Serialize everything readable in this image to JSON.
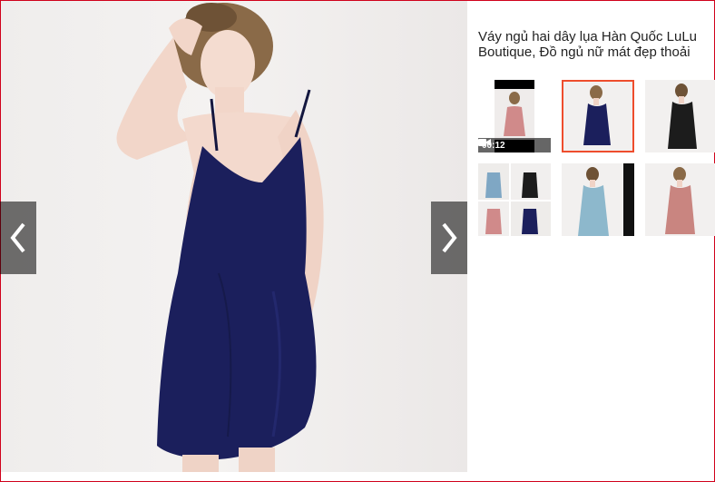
{
  "product": {
    "title_line1": "Váy ngủ hai dây lụa Hàn Quốc LuLu",
    "title_line2": "Boutique, Đồ ngủ nữ mát đẹp thoải"
  },
  "gallery": {
    "video_duration": "00:12",
    "thumbnails": [
      {
        "kind": "video",
        "dress_color": "#d08a8a"
      },
      {
        "kind": "image",
        "dress_color": "#1b1f5c"
      },
      {
        "kind": "image",
        "dress_color": "#1c1c1c"
      },
      {
        "kind": "collage",
        "dress_color": "#7fa7c4"
      },
      {
        "kind": "image",
        "dress_color": "#8db8cc"
      },
      {
        "kind": "image",
        "dress_color": "#c98580"
      }
    ]
  },
  "colors": {
    "accent": "#ee4d2d",
    "frame": "#d0011b",
    "main_dress": "#1b1f5c"
  },
  "icons": {
    "prev": "chevron-left-icon",
    "next": "chevron-right-icon",
    "video": "video-camera-icon"
  }
}
